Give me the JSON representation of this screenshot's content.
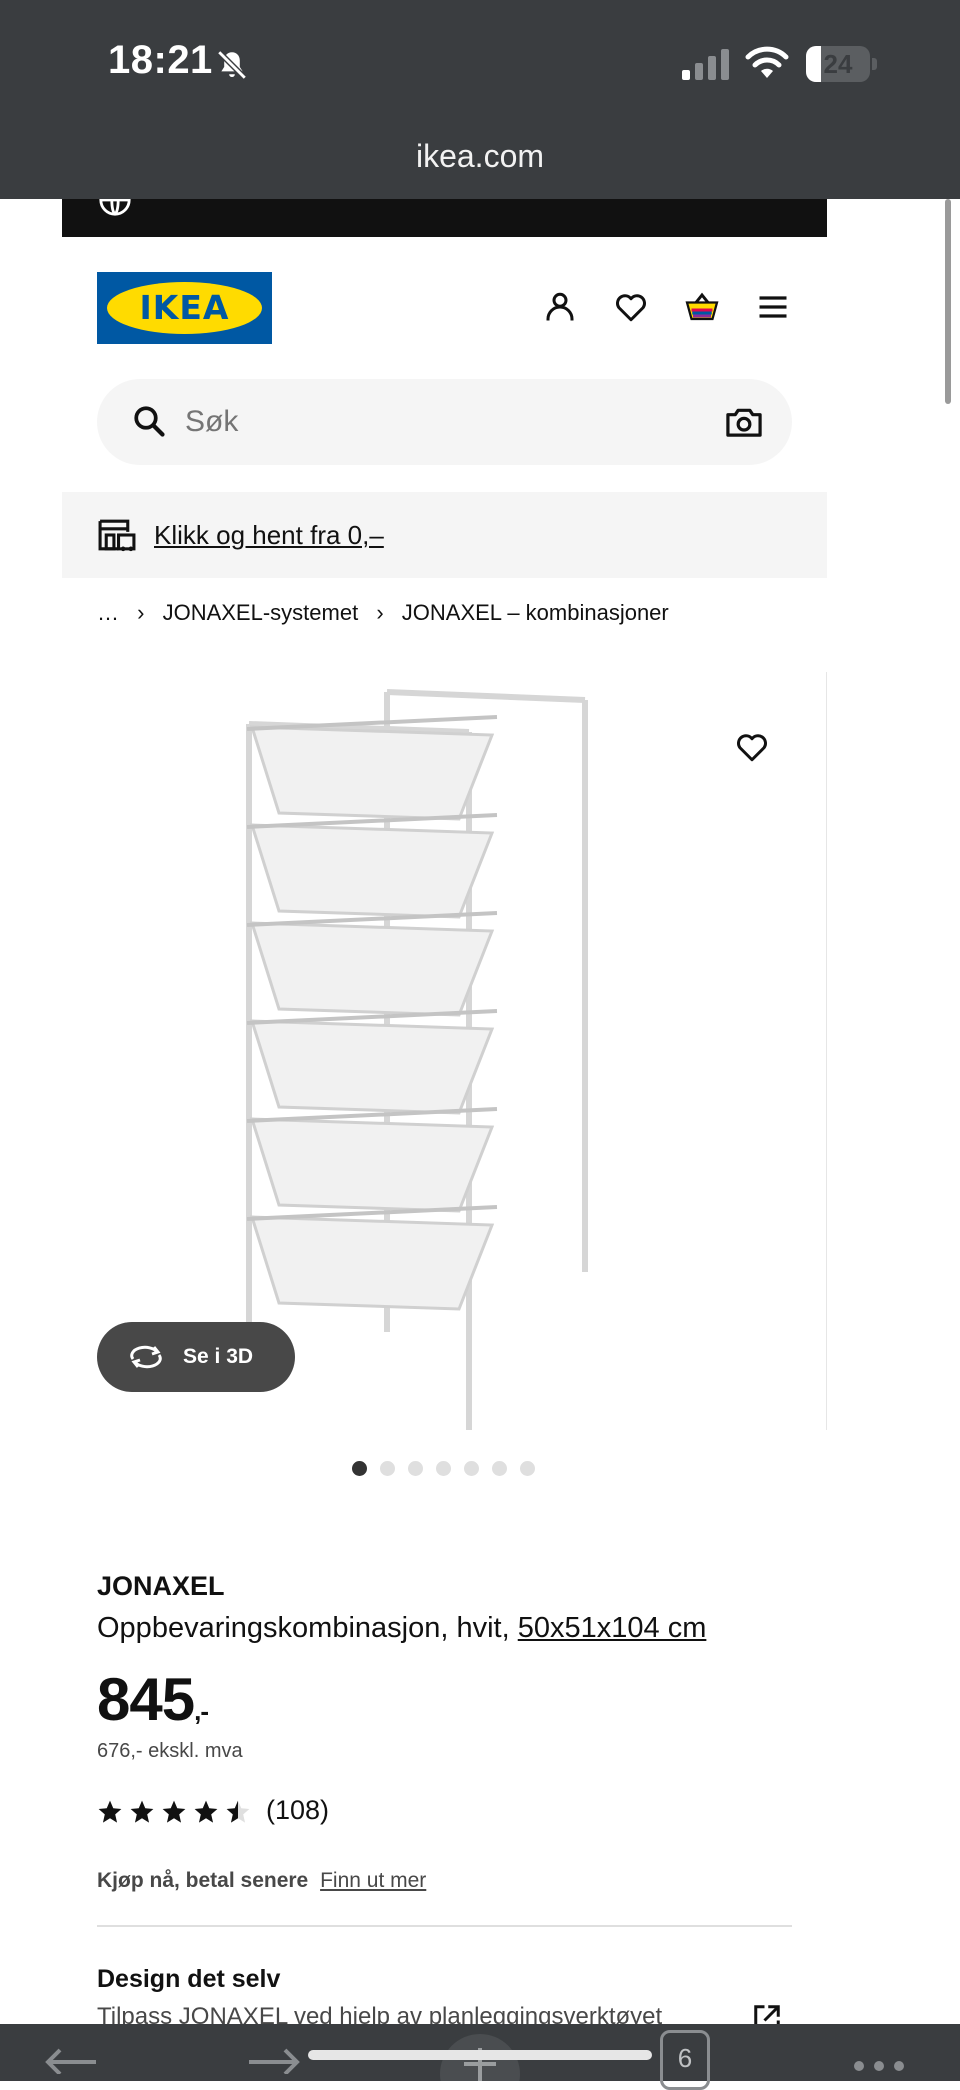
{
  "status_bar": {
    "time": "18:21",
    "battery": "24",
    "battery_level_percent": 24
  },
  "browser": {
    "url": "ikea.com",
    "tabs_count": "6"
  },
  "header": {
    "logo_text": "IKEA",
    "icons": [
      "user-icon",
      "heart-icon",
      "basket-icon",
      "menu-icon"
    ]
  },
  "search": {
    "placeholder": "Søk"
  },
  "promo": {
    "link": "Klikk og hent fra 0,–"
  },
  "breadcrumb": {
    "items": [
      "…",
      "JONAXEL-systemet",
      "JONAXEL – kombinasjoner"
    ]
  },
  "gallery": {
    "view_3d_label": "Se i 3D",
    "dot_count": 7,
    "active_dot": 0
  },
  "product": {
    "name": "JONAXEL",
    "description": "Oppbevaringskombinasjon, hvit,",
    "dimensions": "50x51x104 cm",
    "price": "845",
    "price_suffix": ",-",
    "price_ex_vat": "676,- ekskl. mva",
    "rating": 4.5,
    "reviews": "(108)"
  },
  "payment": {
    "label": "Kjøp nå, betal senere",
    "link": "Finn ut mer"
  },
  "design": {
    "title": "Design det selv",
    "subtitle": "Tilpass JONAXEL ved hjelp av planleggingsverktøyet"
  },
  "colors": {
    "ikea_blue": "#0058a3",
    "ikea_yellow": "#ffdb00",
    "status_bar_bg": "#3a3d40"
  }
}
